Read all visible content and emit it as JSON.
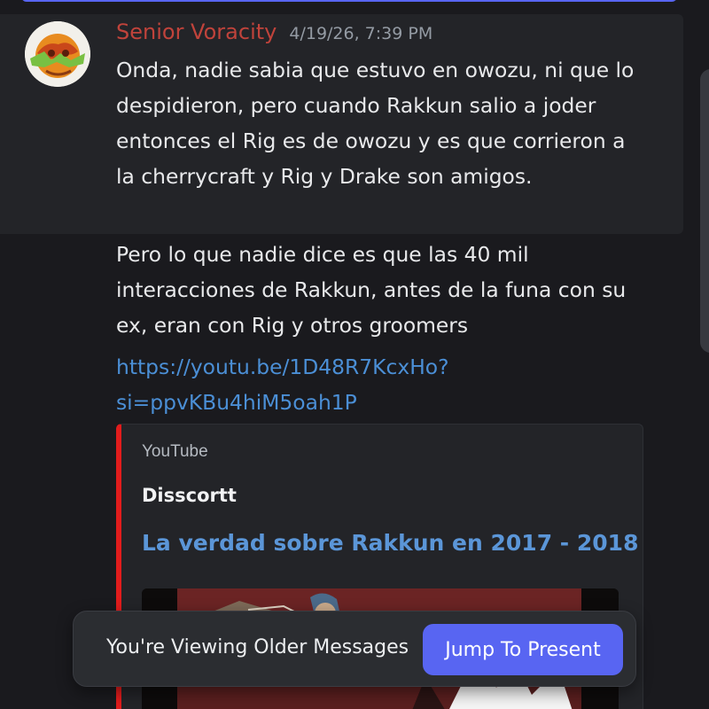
{
  "message": {
    "username": "Senior Voracity",
    "username_color": "#c0433b",
    "timestamp": "4/19/26, 7:39 PM",
    "text_1": "Onda, nadie sabia que estuvo en owozu, ni que lo despidieron, pero cuando Rakkun salio a joder entonces el Rig es de owozu y es que corrieron a la cherrycraft y Rig y Drake son amigos.",
    "text_2": "Pero lo que nadie dice es que las 40 mil interacciones de Rakkun, antes de la funa con su ex, eran con Rig y otros groomers",
    "link": "https://youtu.be/1D48R7KcxHo?si=ppvKBu4hiM5oah1P"
  },
  "embed": {
    "provider": "YouTube",
    "author": "Disscortt",
    "title": "La verdad sobre Rakkun en 2017 - 2018",
    "accent_color": "#e21c1c"
  },
  "banner": {
    "text": "You're Viewing Older Messages",
    "button_label": "Jump To Present",
    "button_color": "#5865f2"
  }
}
